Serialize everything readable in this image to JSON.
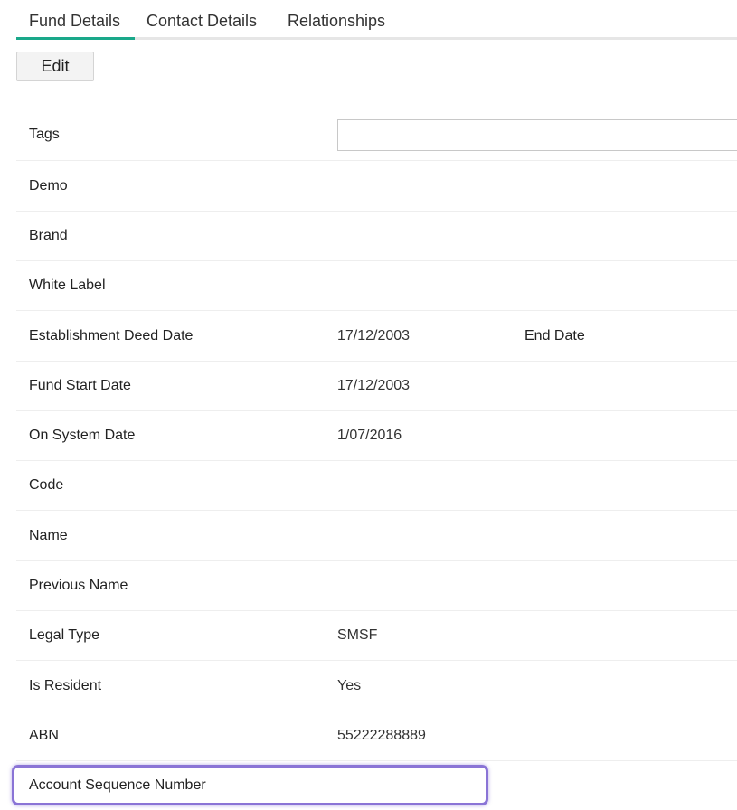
{
  "tabs": [
    {
      "label": "Fund Details",
      "active": true
    },
    {
      "label": "Contact Details",
      "active": false
    },
    {
      "label": "Relationships",
      "active": false
    }
  ],
  "edit_label": "Edit",
  "fields": {
    "tags": {
      "label": "Tags",
      "value": ""
    },
    "demo": {
      "label": "Demo",
      "value": ""
    },
    "brand": {
      "label": "Brand",
      "value": ""
    },
    "white_label": {
      "label": "White Label",
      "value": ""
    },
    "establishment_deed_date": {
      "label": "Establishment Deed Date",
      "value": "17/12/2003"
    },
    "end_date": {
      "label": "End Date",
      "value": ""
    },
    "fund_start_date": {
      "label": "Fund Start Date",
      "value": "17/12/2003"
    },
    "on_system_date": {
      "label": "On System Date",
      "value": "1/07/2016"
    },
    "code": {
      "label": "Code",
      "value": ""
    },
    "name": {
      "label": "Name",
      "value": ""
    },
    "previous_name": {
      "label": "Previous Name",
      "value": ""
    },
    "legal_type": {
      "label": "Legal Type",
      "value": "SMSF"
    },
    "is_resident": {
      "label": "Is Resident",
      "value": "Yes"
    },
    "abn": {
      "label": "ABN",
      "value": "55222288889"
    },
    "account_sequence_number": {
      "label": "Account Sequence Number",
      "value": ""
    }
  },
  "colors": {
    "active_tab_underline": "#1aa88a",
    "highlight_outline": "#8a74d6"
  }
}
